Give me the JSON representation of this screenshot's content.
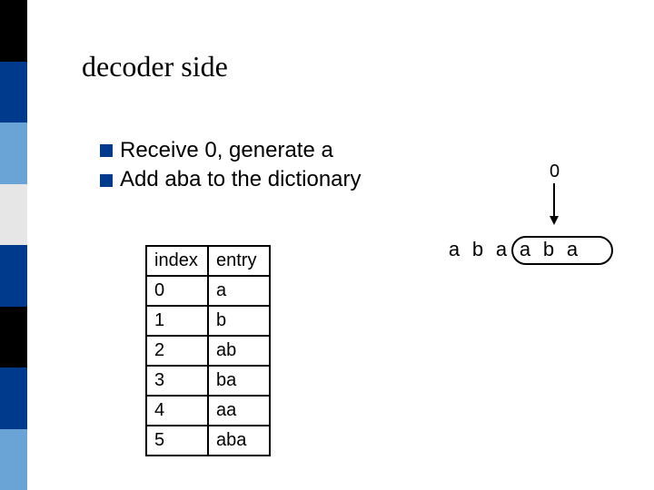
{
  "title": "decoder side",
  "bullets": [
    "Receive 0, generate a",
    "Add aba to the dictionary"
  ],
  "table": {
    "headers": [
      "index",
      "entry"
    ],
    "rows": [
      [
        "0",
        "a"
      ],
      [
        "1",
        "b"
      ],
      [
        "2",
        "ab"
      ],
      [
        "3",
        "ba"
      ],
      [
        "4",
        "aa"
      ],
      [
        "5",
        "aba"
      ]
    ]
  },
  "pointer_label": "0",
  "sequence": [
    "a",
    "b",
    "a",
    "a",
    "b",
    "a"
  ],
  "stripe_colors": [
    "#000000",
    "#003a8c",
    "#6aa3d5",
    "#e6e6e6",
    "#003a8c",
    "#000000",
    "#003a8c",
    "#6aa3d5"
  ]
}
